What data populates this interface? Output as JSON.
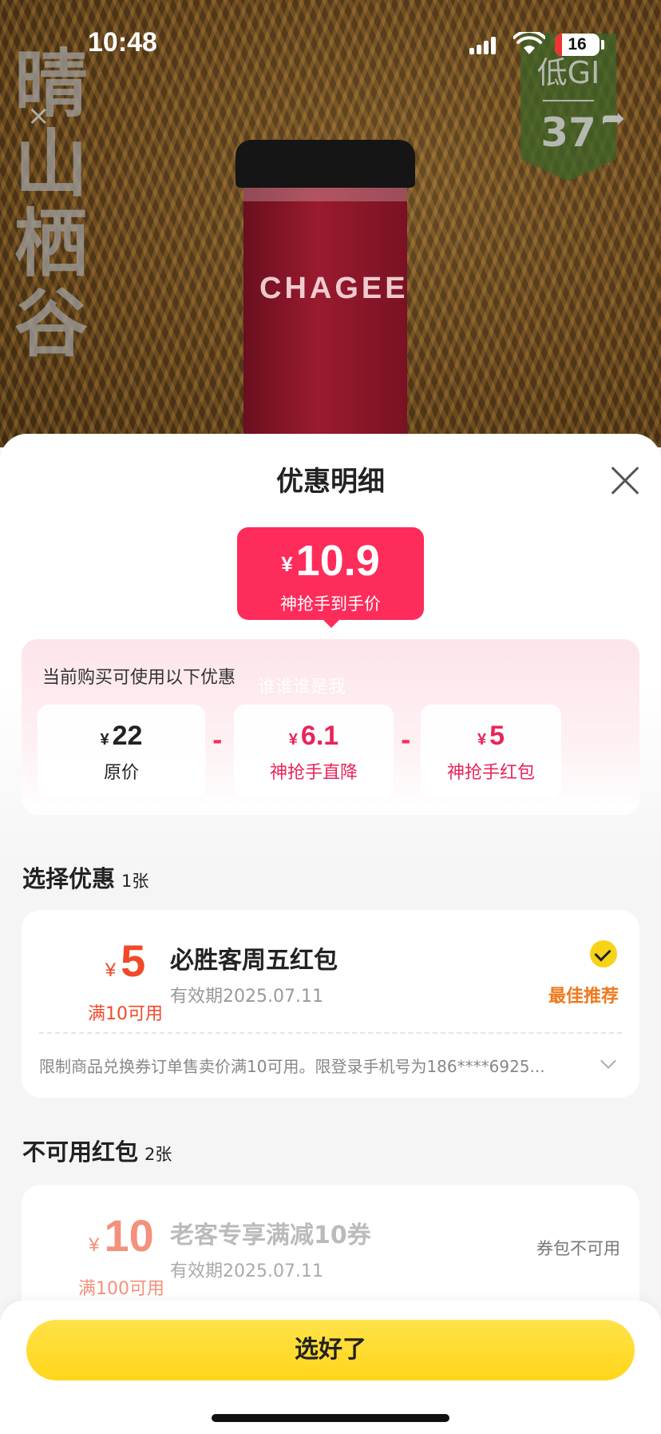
{
  "status_bar": {
    "time": "10:48",
    "battery": "16",
    "battery_level": 0.16
  },
  "hero": {
    "brand_vertical": "晴山栖谷",
    "brand_x": "×",
    "cup_logo": "CHAGEE",
    "gi_label": "低GI",
    "gi_value": "37"
  },
  "sheet": {
    "title": "优惠明细",
    "final_price": {
      "currency": "¥",
      "value": "10.9",
      "label": "神抢手到手价"
    },
    "breakdown": {
      "hint": "当前购买可使用以下优惠",
      "watermark": "谁谁谁是我",
      "items": [
        {
          "currency": "¥",
          "value": "22",
          "label": "原价"
        },
        {
          "currency": "¥",
          "value": "6.1",
          "label": "神抢手直降"
        },
        {
          "currency": "¥",
          "value": "5",
          "label": "神抢手红包"
        }
      ],
      "operator": "-"
    },
    "select_section": {
      "title": "选择优惠",
      "count": "1张"
    },
    "selected_coupon": {
      "currency": "¥",
      "amount": "5",
      "condition": "满10可用",
      "name": "必胜客周五红包",
      "validity": "有效期2025.07.11",
      "badge": "最佳推荐",
      "rule": "限制商品兑换券订单售卖价满10可用。限登录手机号为186****6925..."
    },
    "unavailable_section": {
      "title": "不可用红包",
      "count": "2张"
    },
    "unavailable_coupon": {
      "currency": "¥",
      "amount": "10",
      "condition": "满100可用",
      "name": "老客专享满减10券",
      "validity": "有效期2025.07.11",
      "status": "券包不可用"
    },
    "confirm_label": "选好了"
  },
  "colors": {
    "accent": "#fe2c5a",
    "button": "#ffd61a",
    "coupon_red": "#f04a2a",
    "best_orange": "#f0781a"
  }
}
